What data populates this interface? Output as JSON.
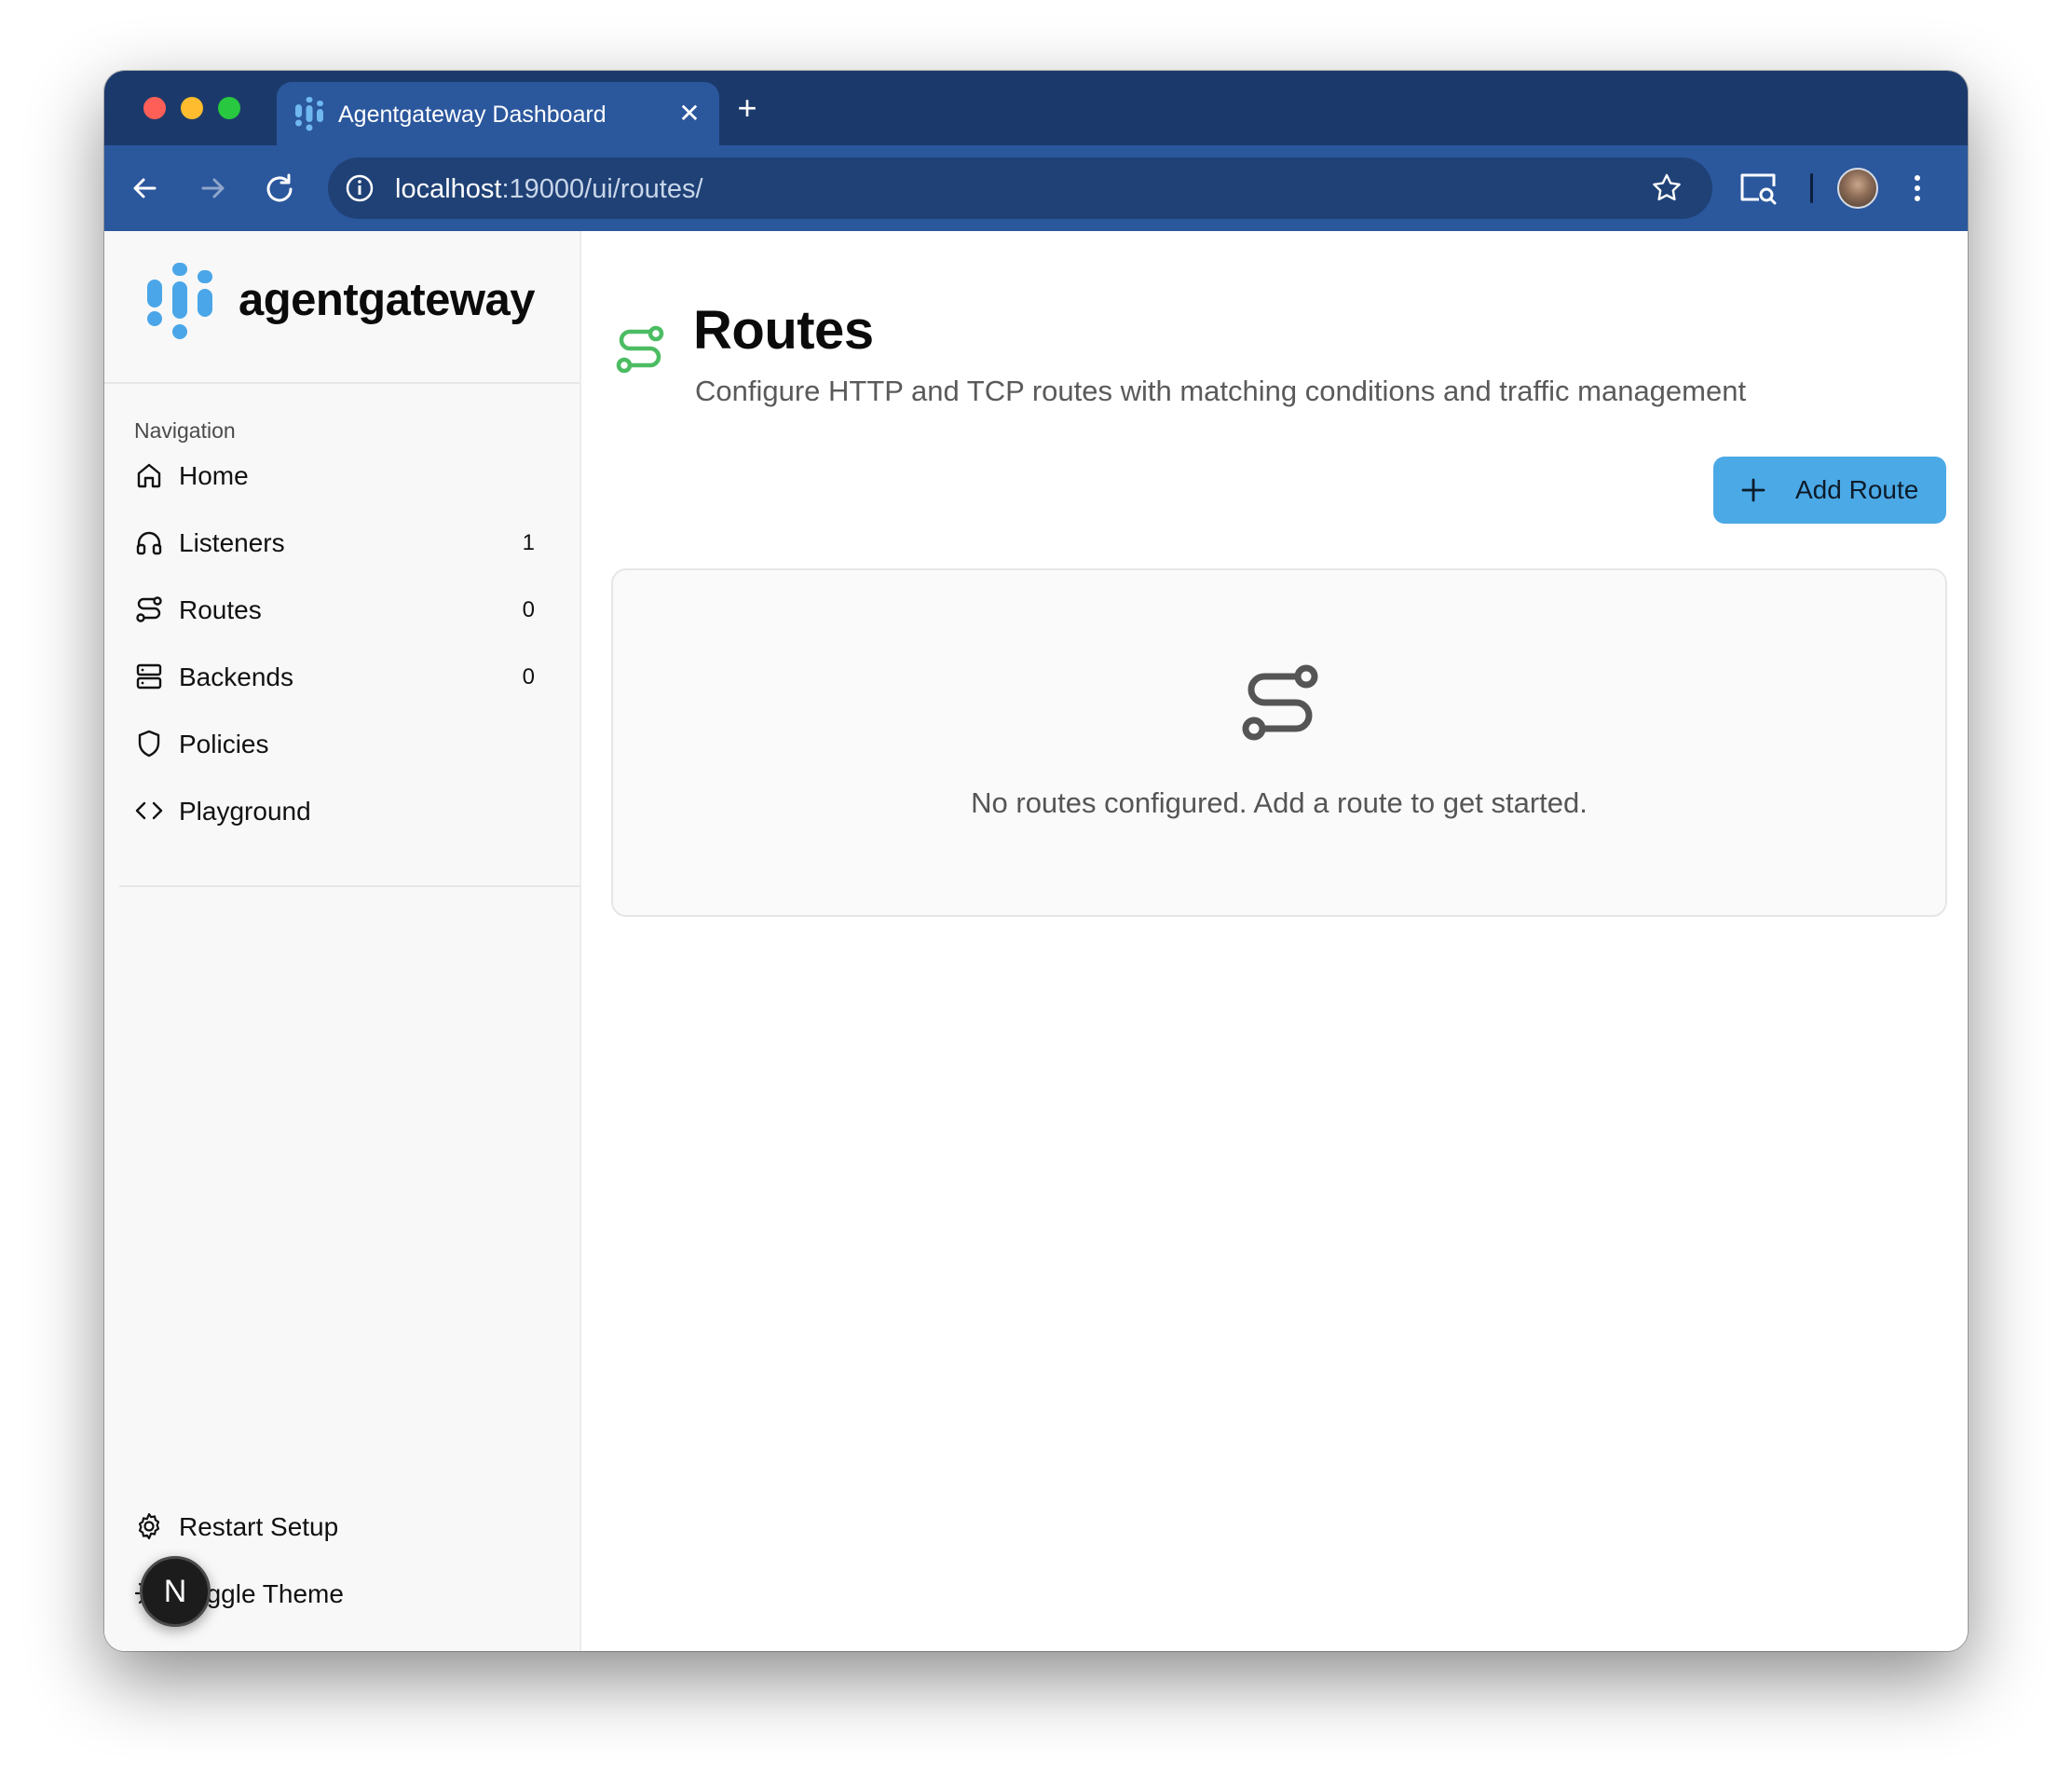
{
  "browser": {
    "tab_title": "Agentgateway Dashboard",
    "tab_close": "✕",
    "new_tab": "+",
    "url_host": "localhost",
    "url_rest": ":19000/ui/routes/"
  },
  "sidebar": {
    "brand_name": "agentgateway",
    "nav_label": "Navigation",
    "items": [
      {
        "label": "Home",
        "count": "",
        "icon": "home-icon"
      },
      {
        "label": "Listeners",
        "count": "1",
        "icon": "headphones-icon"
      },
      {
        "label": "Routes",
        "count": "0",
        "icon": "route-icon"
      },
      {
        "label": "Backends",
        "count": "0",
        "icon": "server-icon"
      },
      {
        "label": "Policies",
        "count": "",
        "icon": "shield-icon"
      },
      {
        "label": "Playground",
        "count": "",
        "icon": "code-icon"
      }
    ],
    "footer": {
      "restart_label": "Restart Setup",
      "theme_label": "Toggle Theme",
      "badge_letter": "N"
    }
  },
  "main": {
    "title": "Routes",
    "subtitle": "Configure HTTP and TCP routes with matching conditions and traffic management",
    "add_button_label": "Add Route",
    "empty_message": "No routes configured. Add a route to get started."
  },
  "colors": {
    "tabbar": "#1b3a6b",
    "toolbar": "#2b579d",
    "accent_green": "#4cbc63",
    "button_blue": "#4ba9e6",
    "brand_blue": "#4aa6e8"
  }
}
